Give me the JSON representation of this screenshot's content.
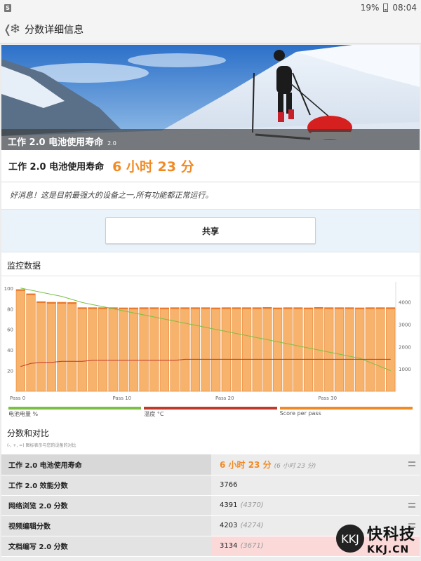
{
  "status_bar": {
    "sim_label": "S",
    "battery": "19%",
    "time": "08:04"
  },
  "app_bar": {
    "back_icon": "chevron-left-icon",
    "logo_icon": "snowflake-icon",
    "title": "分数详细信息"
  },
  "hero": {
    "title": "工作 2.0 电池使用寿命",
    "version": "2.0"
  },
  "score": {
    "label": "工作 2.0 电池使用寿命",
    "value": "6 小时 23 分"
  },
  "message": "好消息！这是目前最强大的设备之一,所有功能都正常运行。",
  "share_button": "共享",
  "monitor_title": "监控数据",
  "chart_data": {
    "type": "bar",
    "x": [
      0,
      1,
      2,
      3,
      4,
      5,
      6,
      7,
      8,
      9,
      10,
      11,
      12,
      13,
      14,
      15,
      16,
      17,
      18,
      19,
      20,
      21,
      22,
      23,
      24,
      25,
      26,
      27,
      28,
      29,
      30,
      31,
      32,
      33,
      34,
      35,
      36
    ],
    "x_tick_labels": [
      "Pass 0",
      "Pass 10",
      "Pass 20",
      "Pass 30"
    ],
    "y_left_ticks": [
      "100",
      "80",
      "60",
      "40",
      "20"
    ],
    "y_right_ticks": [
      "4000",
      "3000",
      "2000",
      "1000"
    ],
    "ylim_left": [
      0,
      106
    ],
    "ylim_right": [
      0,
      4900
    ],
    "series": [
      {
        "name": "Score per pass",
        "axis": "right",
        "color": "#f28a24",
        "values": [
          4560,
          4370,
          4020,
          3990,
          3990,
          3980,
          3750,
          3750,
          3750,
          3750,
          3740,
          3740,
          3750,
          3750,
          3740,
          3750,
          3750,
          3750,
          3750,
          3740,
          3750,
          3750,
          3750,
          3750,
          3760,
          3740,
          3750,
          3750,
          3740,
          3760,
          3750,
          3750,
          3750,
          3740,
          3750,
          3750,
          3750
        ]
      },
      {
        "name": "电池电量 %",
        "axis": "left",
        "color": "#7ac143",
        "values": [
          100,
          98,
          96,
          94,
          92,
          89,
          86,
          84,
          82,
          80,
          78,
          76,
          74,
          72,
          70,
          68,
          66,
          64,
          62,
          60,
          58,
          56,
          54,
          52,
          50,
          48,
          46,
          44,
          42,
          40,
          38,
          36,
          34,
          32,
          28,
          24,
          20
        ]
      },
      {
        "name": "温度 °C",
        "axis": "left",
        "color": "#c0392b",
        "values": [
          24,
          27,
          28,
          28,
          29,
          29,
          29,
          30,
          30,
          30,
          30,
          30,
          30,
          30,
          30,
          30,
          31,
          31,
          31,
          31,
          31,
          31,
          31,
          31,
          31,
          31,
          31,
          31,
          31,
          31,
          31,
          31,
          31,
          31,
          31,
          31,
          31
        ]
      }
    ],
    "legend": [
      "电池电量 %",
      "温度 °C",
      "Score per pass"
    ],
    "legend_colors": [
      "#7ac143",
      "#c0392b",
      "#f28a24"
    ]
  },
  "compare": {
    "title": "分数和对比",
    "subtitle": "(-, +, =) 图标表示与您的设备的对比"
  },
  "rows": [
    {
      "name": "工作 2.0 电池使用寿命",
      "value": "6 小时 23 分",
      "compare": "(6 小时 23 分)"
    },
    {
      "name": "工作 2.0 效能分数",
      "value": "3766",
      "compare": ""
    },
    {
      "name": "网络浏览 2.0 分数",
      "value": "4391",
      "compare": "(4370)"
    },
    {
      "name": "视频编辑分数",
      "value": "4203",
      "compare": "(4274)"
    },
    {
      "name": "文档编写 2.0 分数",
      "value": "3134",
      "compare": "(3671)"
    }
  ],
  "watermark": {
    "circle": "KKJ",
    "text": "快科技",
    "domain": "KKJ.CN"
  }
}
